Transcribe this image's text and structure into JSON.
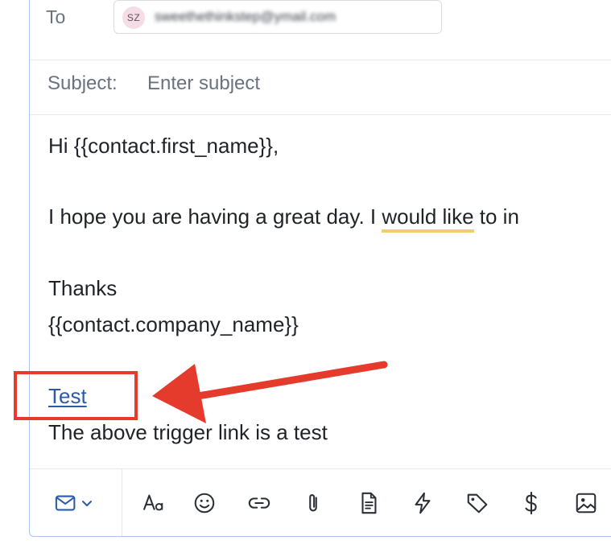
{
  "to": {
    "label": "To",
    "avatar_initials": "SZ",
    "email": "sweethethinkstep@ymail.com"
  },
  "subject": {
    "label": "Subject:",
    "placeholder": "Enter subject",
    "value": ""
  },
  "body": {
    "greeting": "Hi {{contact.first_name}},",
    "line_prefix": "I hope you are having a great day. I ",
    "line_flagged": "would like",
    "line_suffix": " to in",
    "thanks": "Thanks",
    "company_tag": "{{contact.company_name}}",
    "link_text": "Test",
    "link_note": "The above trigger link is a test"
  },
  "toolbar": {
    "icons": [
      "mail-icon",
      "chevron-down-icon",
      "text-format-icon",
      "emoji-icon",
      "link-icon",
      "attachment-icon",
      "template-icon",
      "lightning-icon",
      "tag-icon",
      "dollar-icon",
      "image-icon"
    ]
  },
  "colors": {
    "accent": "#2c5aa8",
    "annotation": "#e53b2c",
    "spell_warning": "#f2cf66",
    "icon": "#2a2f36"
  }
}
